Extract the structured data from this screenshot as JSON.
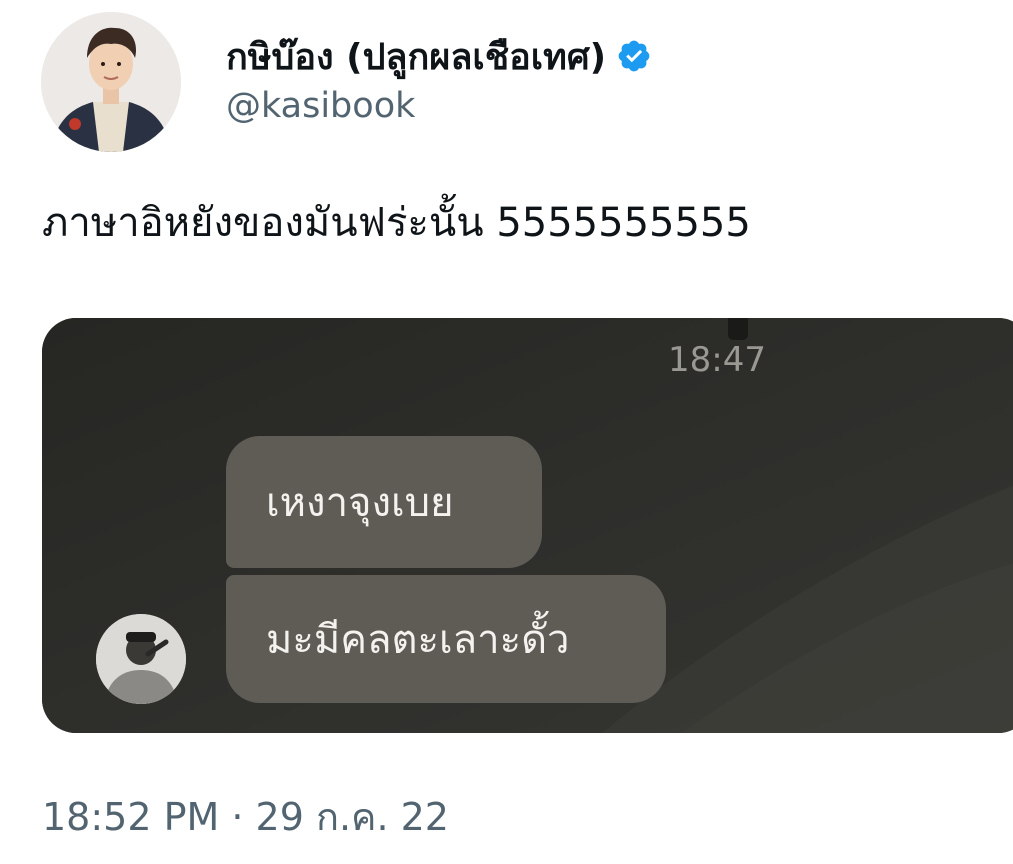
{
  "tweet": {
    "author": {
      "display_name": "กษิบ๊อง (ปลูกผลเชือเทศ)",
      "handle": "@kasibook",
      "verified": true,
      "avatar_icon": "profile-photo"
    },
    "text": "ภาษาอิหยังของมันฟร่ะนั้น 5555555555",
    "timestamp": "18:52 PM · 29 ก.ค. 22",
    "media": {
      "chat_time": "18:47",
      "messages": [
        {
          "text": "เหงาจุงเบย"
        },
        {
          "text": "มะมีคลตะเลาะดั้ว"
        }
      ],
      "sender_avatar_icon": "chat-avatar"
    }
  },
  "colors": {
    "text_primary": "#0f1419",
    "text_secondary": "#536471",
    "verified_blue": "#1d9bf0",
    "media_background": "#2d2d2a",
    "bubble": "#5f5c56",
    "bubble_text": "#f4f2ee",
    "chat_time": "#9a9892"
  }
}
